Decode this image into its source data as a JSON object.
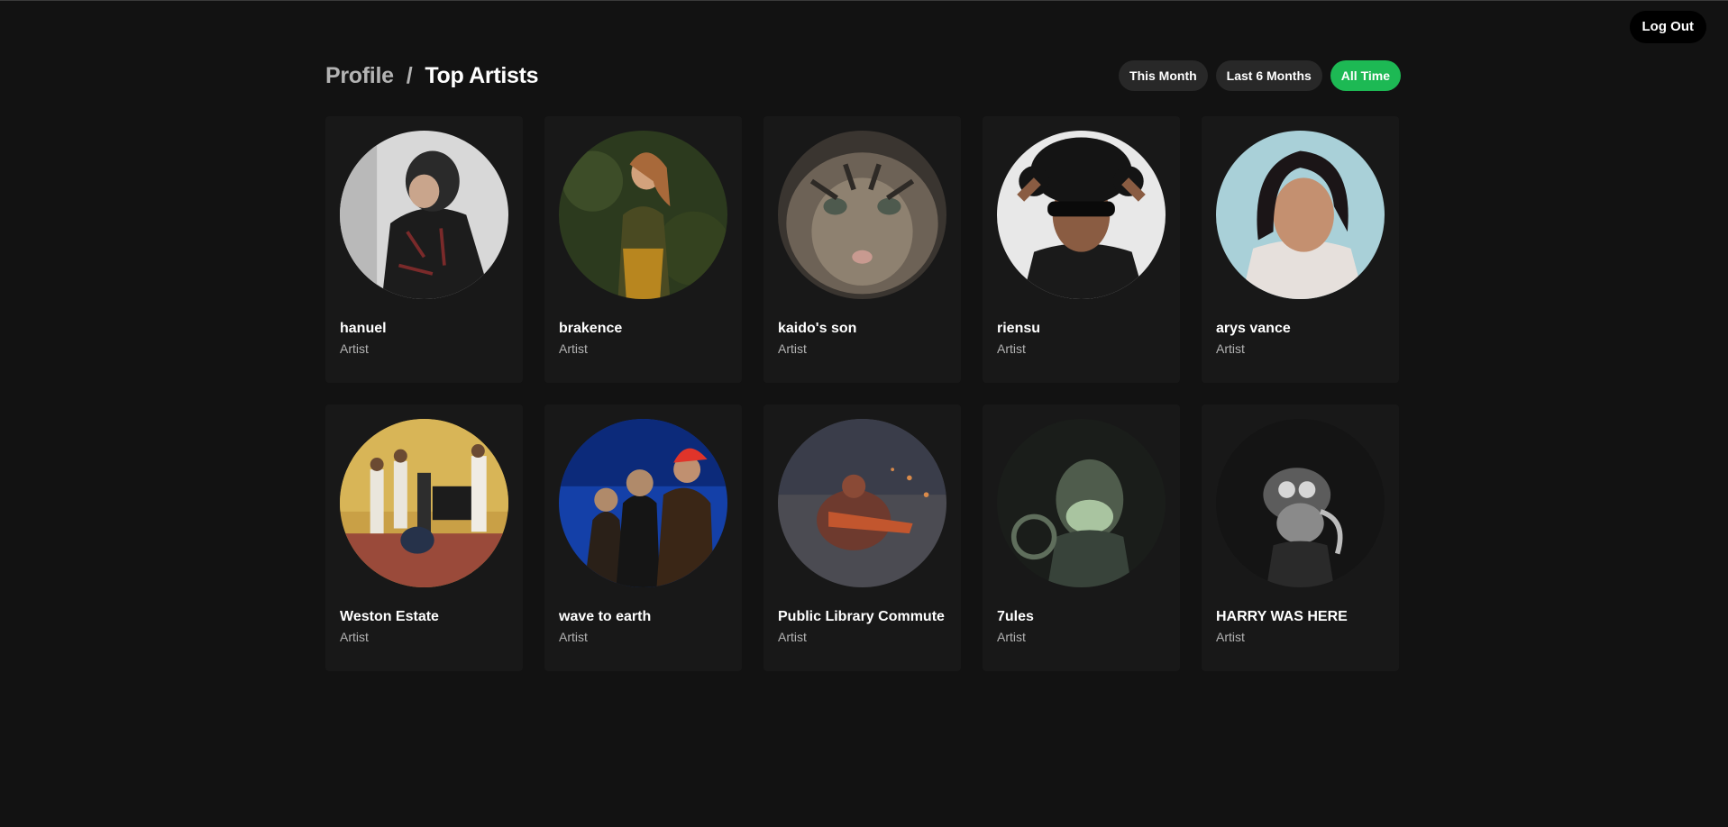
{
  "header": {
    "logout_label": "Log Out",
    "breadcrumb": {
      "parent": "Profile",
      "separator": "/",
      "current": "Top Artists"
    },
    "ranges": [
      {
        "label": "This Month",
        "active": false
      },
      {
        "label": "Last 6 Months",
        "active": false
      },
      {
        "label": "All Time",
        "active": true
      }
    ]
  },
  "accent_color": "#1db954",
  "artists": [
    {
      "name": "hanuel",
      "type": "Artist"
    },
    {
      "name": "brakence",
      "type": "Artist"
    },
    {
      "name": "kaido's son",
      "type": "Artist"
    },
    {
      "name": "riensu",
      "type": "Artist"
    },
    {
      "name": "arys vance",
      "type": "Artist"
    },
    {
      "name": "Weston Estate",
      "type": "Artist"
    },
    {
      "name": "wave to earth",
      "type": "Artist"
    },
    {
      "name": "Public Library Commute",
      "type": "Artist"
    },
    {
      "name": "7ules",
      "type": "Artist"
    },
    {
      "name": "HARRY WAS HERE",
      "type": "Artist"
    }
  ]
}
